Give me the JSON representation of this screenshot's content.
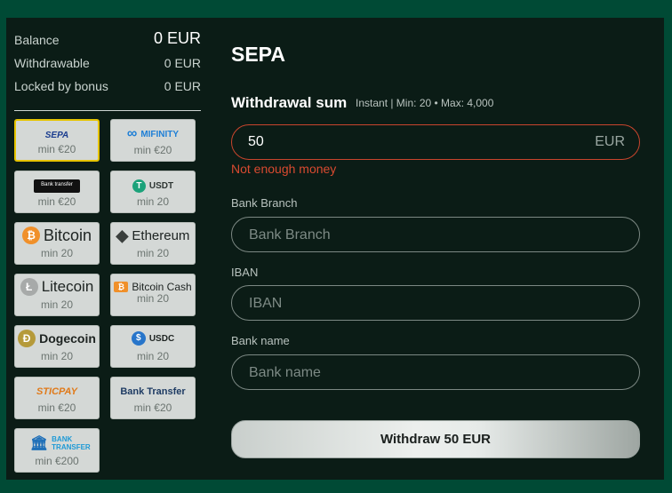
{
  "balance": {
    "rows": [
      {
        "label": "Balance",
        "value": "0 EUR"
      },
      {
        "label": "Withdrawable",
        "value": "0 EUR"
      },
      {
        "label": "Locked by bonus",
        "value": "0 EUR"
      }
    ]
  },
  "methods": [
    {
      "name": "SEPA",
      "min": "min €20",
      "selected": true
    },
    {
      "name": "MIFINITY",
      "min": "min €20"
    },
    {
      "name": "Bank transfer",
      "min": "min €20"
    },
    {
      "name": "USDT",
      "min": "min 20"
    },
    {
      "name": "Bitcoin",
      "min": "min 20"
    },
    {
      "name": "Ethereum",
      "min": "min 20"
    },
    {
      "name": "Litecoin",
      "min": "min 20"
    },
    {
      "name": "Bitcoin Cash",
      "min": "min 20"
    },
    {
      "name": "Dogecoin",
      "min": "min 20"
    },
    {
      "name": "USDC",
      "min": "min 20"
    },
    {
      "name": "STICPAY",
      "min": "min €20"
    },
    {
      "name": "Bank Transfer",
      "min": "min €20"
    },
    {
      "name": "BANK TRANSFER",
      "min": "min €200"
    }
  ],
  "form": {
    "title": "SEPA",
    "sum_label": "Withdrawal sum",
    "sum_hint": "Instant | Min: 20 • Max: 4,000",
    "sum_value": "50",
    "sum_currency": "EUR",
    "sum_error": "Not enough money",
    "fields": [
      {
        "label": "Bank Branch",
        "placeholder": "Bank Branch"
      },
      {
        "label": "IBAN",
        "placeholder": "IBAN"
      },
      {
        "label": "Bank name",
        "placeholder": "Bank name"
      }
    ],
    "submit_label": "Withdraw 50 EUR"
  },
  "colors": {
    "page_bg": "#004a35",
    "panel_bg": "#0b1c16",
    "error": "#d94a30",
    "selected_border": "#e6c400"
  }
}
